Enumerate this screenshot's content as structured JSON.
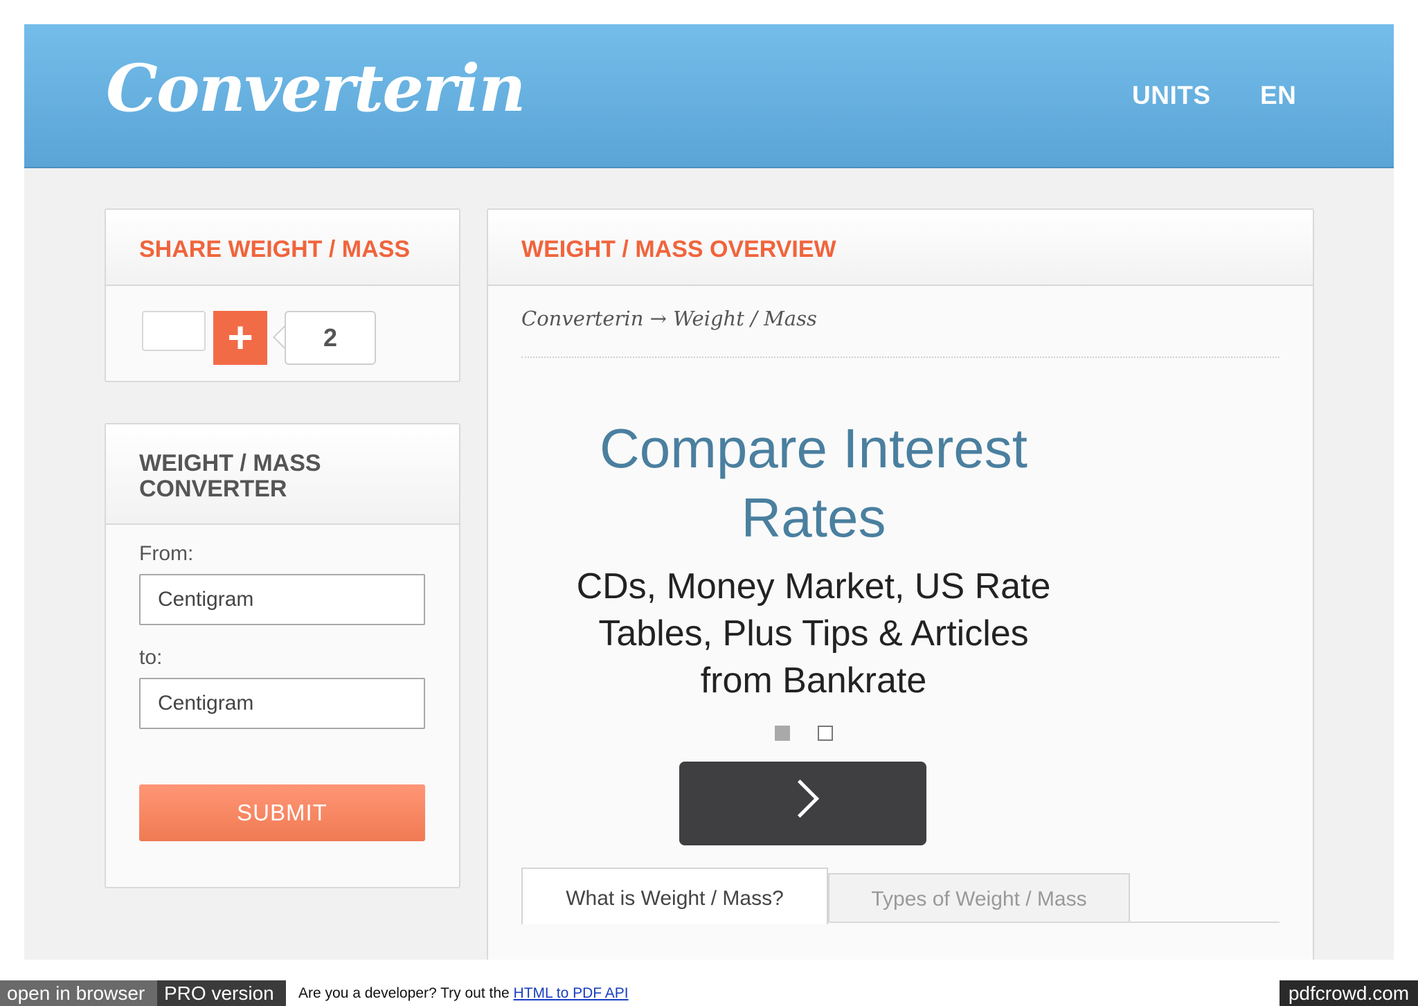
{
  "header": {
    "logo": "Converterin",
    "nav": [
      "UNITS",
      "EN"
    ]
  },
  "share_box": {
    "title": "SHARE WEIGHT / MASS",
    "plus_icon": "+",
    "count": "2"
  },
  "converter_box": {
    "title_line1": "WEIGHT / MASS",
    "title_line2": "CONVERTER",
    "from_label": "From:",
    "from_value": "Centigram",
    "to_label": "to:",
    "to_value": "Centigram",
    "submit_label": "SUBMIT"
  },
  "overview": {
    "title": "WEIGHT / MASS OVERVIEW",
    "breadcrumb": "Converterin → Weight / Mass",
    "ad": {
      "title_line1": "Compare Interest",
      "title_line2": "Rates",
      "text_line1": "CDs, Money Market, US Rate",
      "text_line2": "Tables, Plus Tips & Articles",
      "text_line3": "from Bankrate"
    },
    "tabs": [
      "What is Weight / Mass?",
      "Types of Weight / Mass"
    ]
  },
  "footer": {
    "open_label": "open in browser",
    "pro_label": "PRO version",
    "note": "Are you a developer? Try out the ",
    "link": "HTML to PDF API",
    "brand": "pdfcrowd.com"
  }
}
